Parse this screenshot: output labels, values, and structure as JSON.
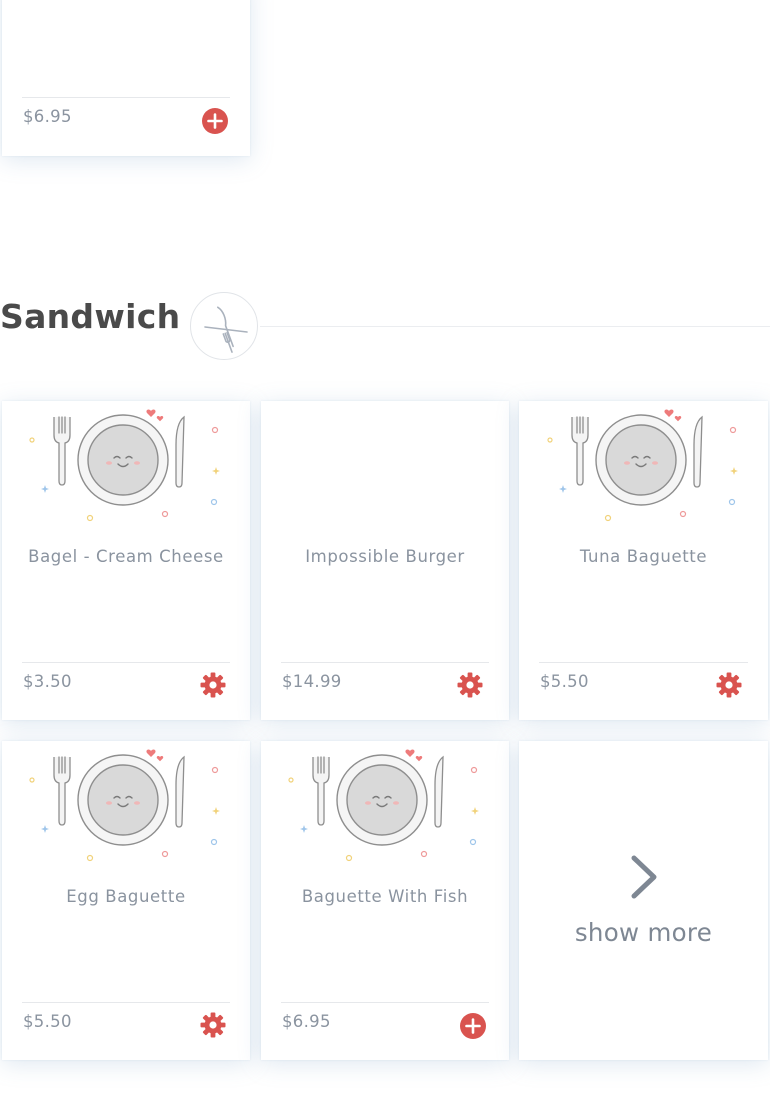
{
  "top_card": {
    "price": "$6.95",
    "action_icon": "plus-circle-icon"
  },
  "section": {
    "title": "Sandwich",
    "icon": "fork-knife-icon"
  },
  "items": [
    {
      "name": "Bagel - Cream Cheese",
      "price": "$3.50",
      "image": "plate-illustration",
      "action_icon": "gear-icon"
    },
    {
      "name": "Impossible Burger",
      "price": "$14.99",
      "image": "",
      "action_icon": "gear-icon"
    },
    {
      "name": "Tuna Baguette",
      "price": "$5.50",
      "image": "plate-illustration",
      "action_icon": "gear-icon"
    },
    {
      "name": "Egg Baguette",
      "price": "$5.50",
      "image": "plate-illustration",
      "action_icon": "gear-icon"
    },
    {
      "name": "Baguette With Fish",
      "price": "$6.95",
      "image": "plate-illustration",
      "action_icon": "plus-circle-icon"
    }
  ],
  "show_more": {
    "label": "show more",
    "icon": "chevron-right-icon"
  },
  "colors": {
    "accent": "#d9534f",
    "text": "#8a939f",
    "title": "#4a4a4a"
  }
}
